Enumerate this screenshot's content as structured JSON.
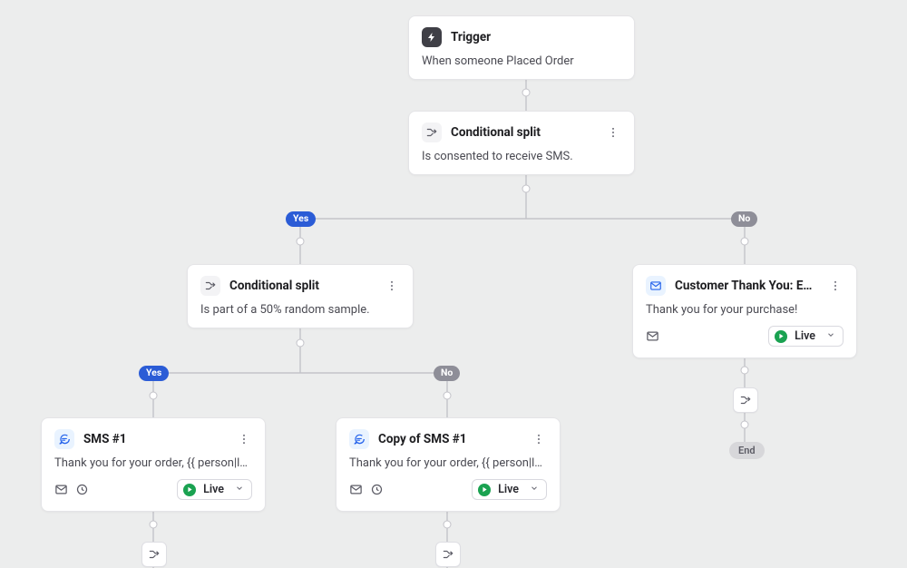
{
  "trigger": {
    "title": "Trigger",
    "desc": "When someone Placed Order"
  },
  "split1": {
    "title": "Conditional split",
    "desc": "Is consented to receive SMS."
  },
  "branch1": {
    "yes": "Yes",
    "no": "No"
  },
  "split2": {
    "title": "Conditional split",
    "desc": "Is part of a 50% random sample."
  },
  "branch2": {
    "yes": "Yes",
    "no": "No"
  },
  "email1": {
    "title": "Customer Thank You: Email...",
    "desc": "Thank you for your purchase!",
    "status": "Live"
  },
  "sms1": {
    "title": "SMS #1",
    "desc": "Thank you for your order, {{ person|looku...",
    "status": "Live"
  },
  "sms2": {
    "title": "Copy of SMS #1",
    "desc": "Thank you for your order, {{ person|looku...",
    "status": "Live"
  },
  "end": "End"
}
